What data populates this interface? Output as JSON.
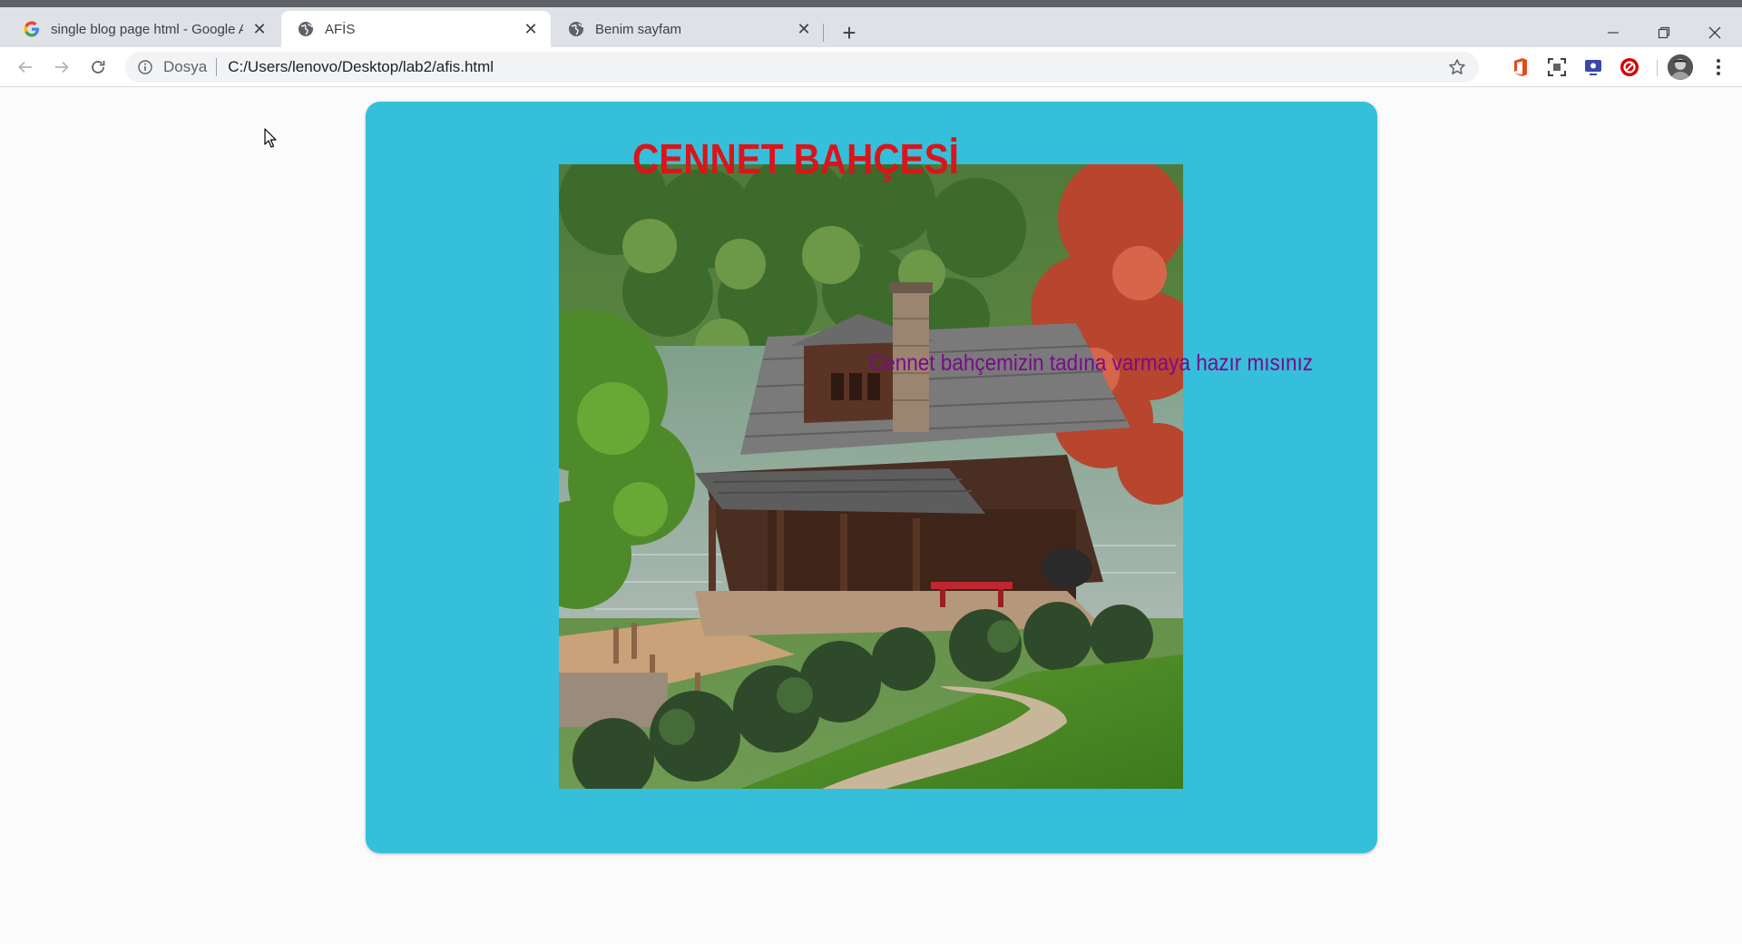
{
  "browser": {
    "tabs": [
      {
        "title": "single blog page html - Google A",
        "favicon": "google-g-icon",
        "active": false
      },
      {
        "title": "AFİS",
        "favicon": "globe-icon",
        "active": true
      },
      {
        "title": "Benim sayfam",
        "favicon": "globe-icon",
        "active": false
      }
    ],
    "new_tab_label": "+",
    "address": {
      "scheme_label": "Dosya",
      "url": "C:/Users/lenovo/Desktop/lab2/afis.html"
    },
    "extensions": [
      "office-icon",
      "screenshot-icon",
      "screen-recorder-icon",
      "adblock-icon"
    ]
  },
  "page": {
    "headline": "CENNET BAHÇESİ",
    "tagline": "Cennet bahçemizin tadına varmaya hazır mısınız",
    "colors": {
      "poster_background": "#35bfda",
      "headline": "#d9151b",
      "tagline": "#7a0a8c"
    }
  }
}
